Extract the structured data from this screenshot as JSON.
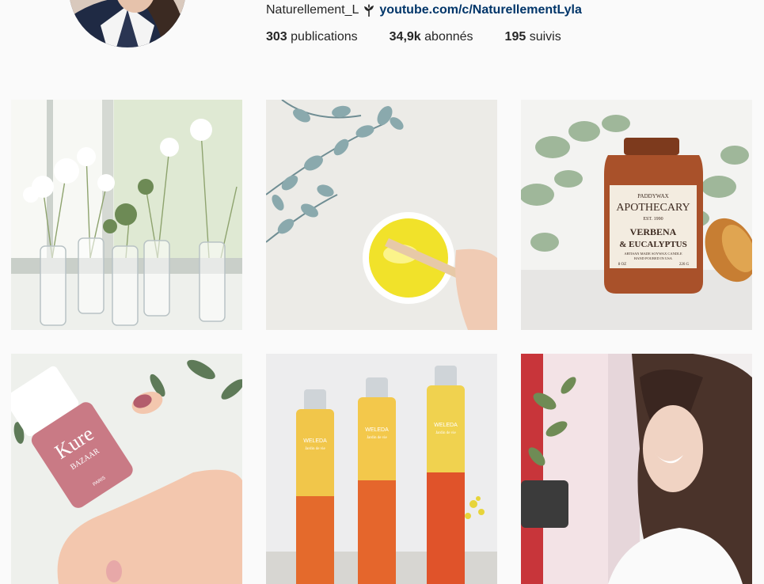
{
  "profile": {
    "bio_name": "Naturellement_L",
    "bio_icon": "plant-icon",
    "website": "youtube.com/c/NaturellementLyla",
    "stats": {
      "posts_count": "303",
      "posts_label": "publications",
      "followers_count": "34,9k",
      "followers_label": "abonnés",
      "following_count": "195",
      "following_label": "suivis"
    }
  },
  "posts": [
    {
      "subject": "flowers in glass bottles on window sill"
    },
    {
      "subject": "bowl of yellow balm with wooden spoon and eucalyptus"
    },
    {
      "subject": "apothecary candle jar",
      "label_brand": "PADDYWAX",
      "label_title": "APOTHECARY",
      "label_est": "EST. 1990",
      "label_scent_1": "VERBENA",
      "label_scent_2": "& EUCALYPTUS",
      "label_small": "ARTISAN MADE SOYWAX CANDLE",
      "label_small_2": "HAND POURED IN USA",
      "label_weight_oz": "8 OZ",
      "label_weight_g": "226 G"
    },
    {
      "subject": "nail polish bottle in hand",
      "label_brand": "Kure",
      "label_brand_2": "BAZAAR",
      "label_city": "PARIS"
    },
    {
      "subject": "three perfume bottles",
      "label_brand": "WELEDA",
      "label_sub": "Jardin de vie"
    },
    {
      "subject": "smiling woman with long brown hair"
    }
  ],
  "colors": {
    "link": "#003569",
    "text": "#262626",
    "background": "#fafafa"
  }
}
